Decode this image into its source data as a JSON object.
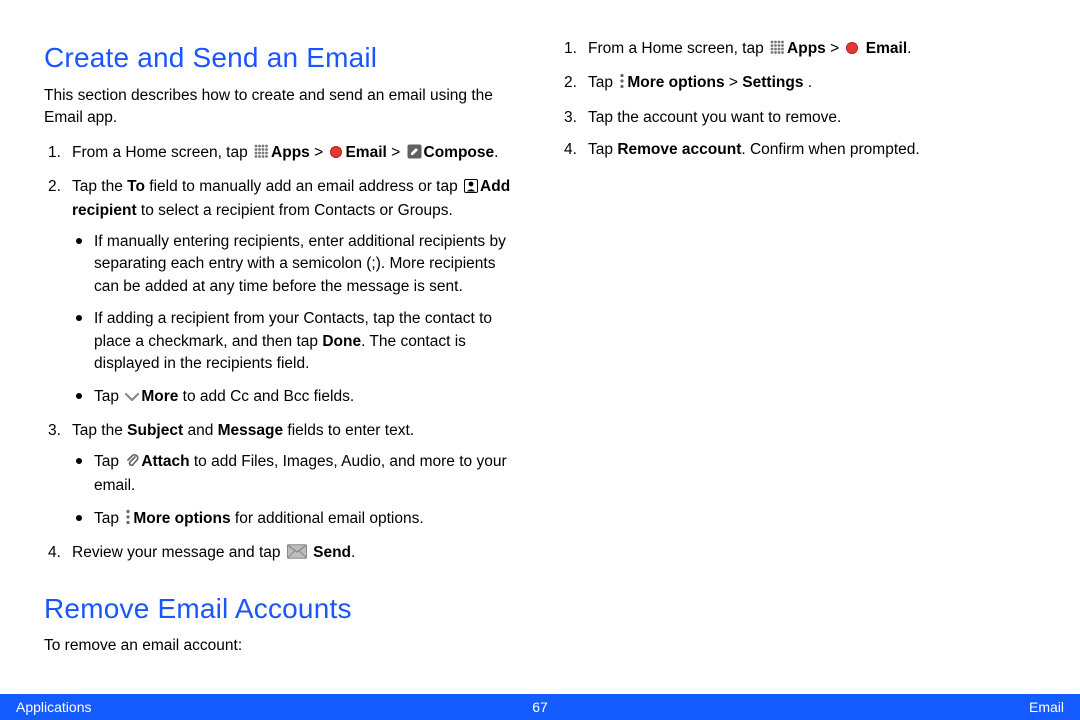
{
  "section1": {
    "heading": "Create and Send an Email",
    "intro": "This section describes how to create and send an email using the Email app.",
    "s1_pre": "From a Home screen, tap ",
    "apps": "Apps",
    "gt": " > ",
    "email": "Email",
    "compose": "Compose",
    "period": ".",
    "s2_pre": "Tap the ",
    "to": "To",
    "s2_mid1": " field to manually add an email address or tap ",
    "addrecip": "Add recipient",
    "s2_post": " to select a recipient from Contacts or Groups.",
    "b2a": "If manually entering recipients, enter additional recipients by separating each entry with a semicolon (;). More recipients can be added at any time before the message is sent.",
    "b2b_pre": "If adding a recipient from your Contacts, tap the contact to place a checkmark, and then tap ",
    "done": "Done",
    "b2b_post": ". The contact is displayed in the recipients field.",
    "b2c_pre": "Tap ",
    "more": "More",
    "b2c_post": " to add Cc and Bcc fields.",
    "s3_pre": "Tap the ",
    "subject": "Subject",
    "and": " and ",
    "message": "Message",
    "s3_post": " fields to enter text.",
    "b3a_pre": "Tap ",
    "attach": "Attach",
    "b3a_post": " to add Files, Images, Audio, and more to your email.",
    "b3b_pre": "Tap ",
    "moreopt": "More options",
    "b3b_post": " for additional email options.",
    "s4_pre": "Review your message and tap ",
    "send": "Send"
  },
  "section2": {
    "heading": "Remove Email Accounts",
    "intro": "To remove an email account:",
    "s1_pre": "From a Home screen, tap ",
    "s2_pre": "Tap ",
    "settings": "Settings",
    "s2_post": " .",
    "s3": "Tap the account you want to remove.",
    "s4_pre": "Tap ",
    "removeacct": "Remove account",
    "s4_post": ". Confirm when prompted."
  },
  "footer": {
    "left": "Applications",
    "page": "67",
    "right": "Email"
  }
}
